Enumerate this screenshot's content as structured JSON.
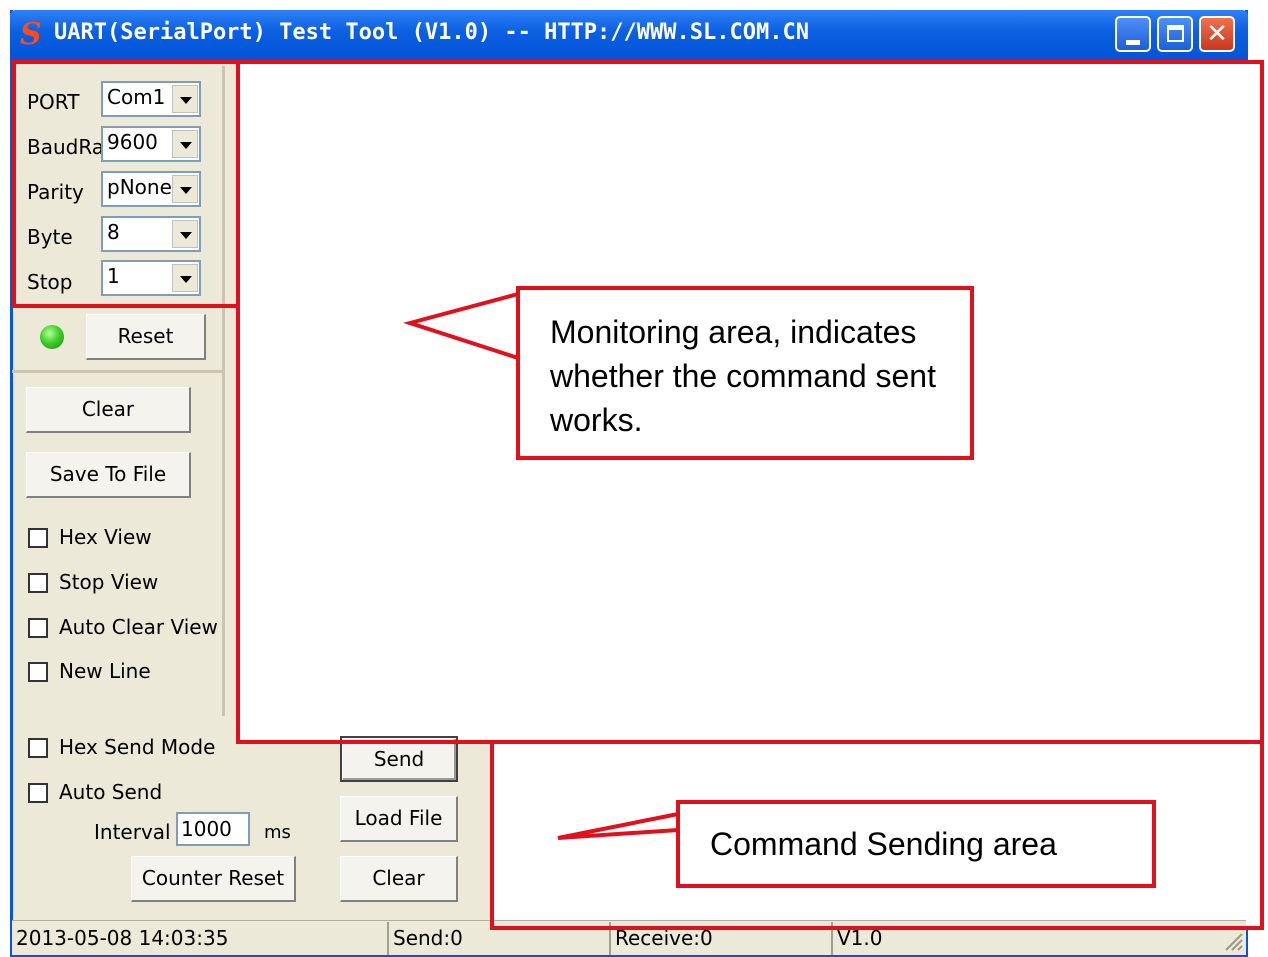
{
  "window": {
    "title": "UART(SerialPort) Test Tool (V1.0) -- HTTP://WWW.SL.COM.CN",
    "logo_glyph": "S"
  },
  "settings": {
    "port_label": "PORT",
    "port_value": "Com1",
    "baud_label": "BaudRa",
    "baud_value": "9600",
    "parity_label": "Parity",
    "parity_value": "pNone",
    "byte_label": "Byte",
    "byte_value": "8",
    "stop_label": "Stop",
    "stop_value": "1"
  },
  "controls": {
    "reset_label": "Reset",
    "clear_label": "Clear",
    "save_to_file_label": "Save To File",
    "hex_view_label": "Hex View",
    "stop_view_label": "Stop View",
    "auto_clear_view_label": "Auto Clear View",
    "new_line_label": "New Line",
    "hex_send_mode_label": "Hex Send Mode",
    "auto_send_label": "Auto Send",
    "interval_label": "Interval",
    "interval_value": "1000",
    "interval_unit": "ms",
    "counter_reset_label": "Counter Reset",
    "send_label": "Send",
    "load_file_label": "Load File",
    "send_clear_label": "Clear"
  },
  "status_bar": {
    "datetime": "2013-05-08 14:03:35",
    "send": "Send:0",
    "receive": "Receive:0",
    "version": "V1.0"
  },
  "annotations": {
    "monitoring": "Monitoring area, indicates whether the command sent works.",
    "command_sending": "Command Sending area"
  },
  "colors": {
    "annotation_red": "#e0101c",
    "titlebar_blue": "#0a5fe0",
    "led_green": "#3fcf2a"
  }
}
